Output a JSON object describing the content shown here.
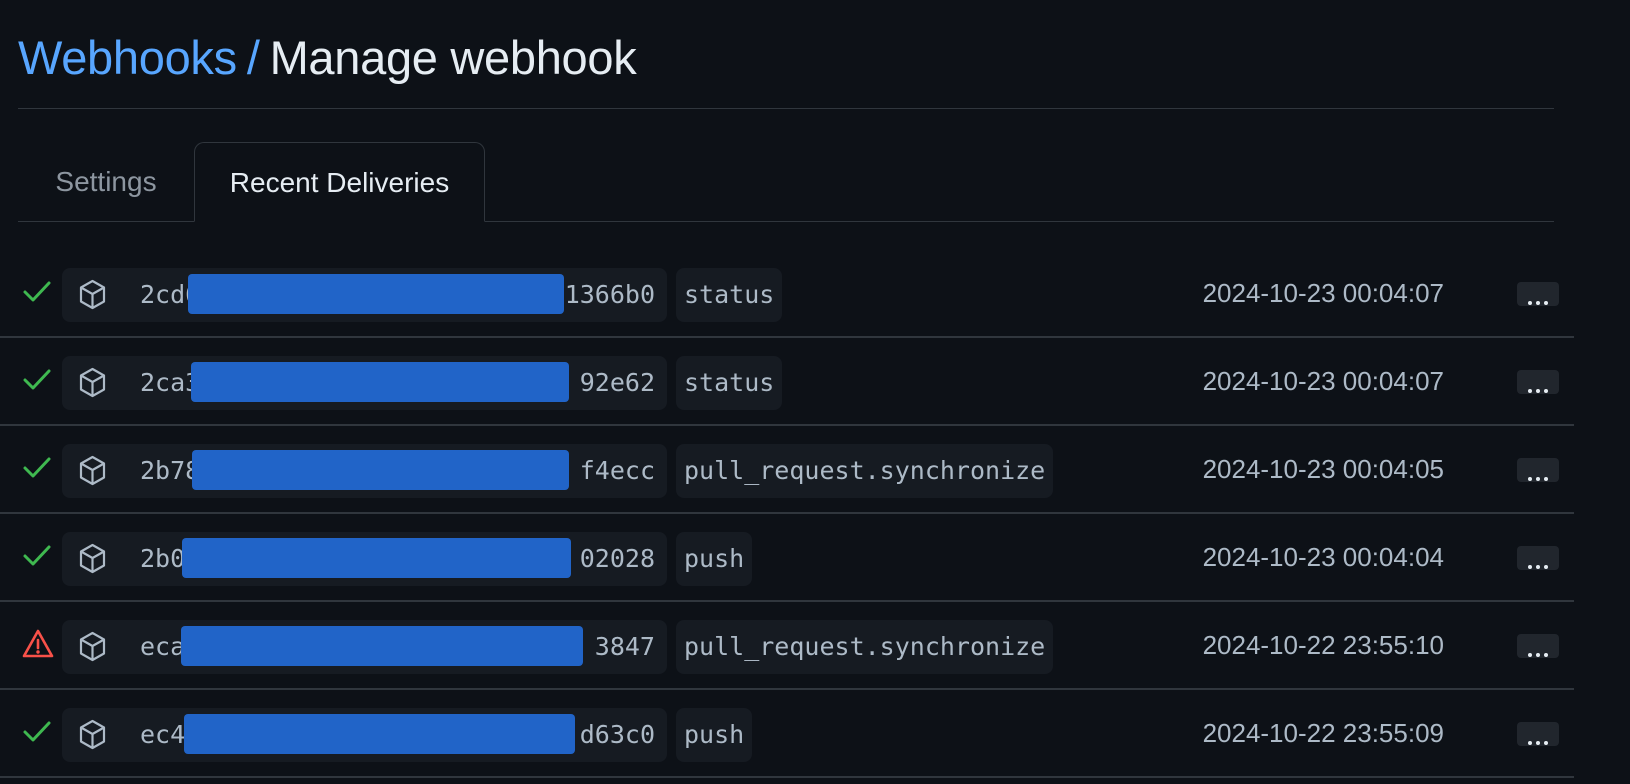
{
  "breadcrumb": {
    "parent": "Webhooks",
    "separator": "/",
    "current": "Manage webhook"
  },
  "tabs": [
    {
      "label": "Settings",
      "active": false
    },
    {
      "label": "Recent Deliveries",
      "active": true
    }
  ],
  "colors": {
    "background": "#0d1117",
    "link": "#58a6ff",
    "success": "#3fb950",
    "error": "#f85149",
    "redaction": "#2164c8"
  },
  "deliveries": [
    {
      "status": "success",
      "status_icon": "check-icon",
      "guid_start": "2cd6",
      "guid_end": "1366b0",
      "event": "status",
      "timestamp": "2024-10-23 00:04:07"
    },
    {
      "status": "success",
      "status_icon": "check-icon",
      "guid_start": "2ca3",
      "guid_end": "92e62",
      "event": "status",
      "timestamp": "2024-10-23 00:04:07"
    },
    {
      "status": "success",
      "status_icon": "check-icon",
      "guid_start": "2b78",
      "guid_end": "f4ecc",
      "event": "pull_request.synchronize",
      "timestamp": "2024-10-23 00:04:05"
    },
    {
      "status": "success",
      "status_icon": "check-icon",
      "guid_start": "2b0",
      "guid_end": "02028",
      "event": "push",
      "timestamp": "2024-10-23 00:04:04"
    },
    {
      "status": "error",
      "status_icon": "alert-icon",
      "guid_start": "eca",
      "guid_end": "3847",
      "event": "pull_request.synchronize",
      "timestamp": "2024-10-22 23:55:10"
    },
    {
      "status": "success",
      "status_icon": "check-icon",
      "guid_start": "ec4",
      "guid_end": "d63c0",
      "event": "push",
      "timestamp": "2024-10-22 23:55:09"
    }
  ]
}
